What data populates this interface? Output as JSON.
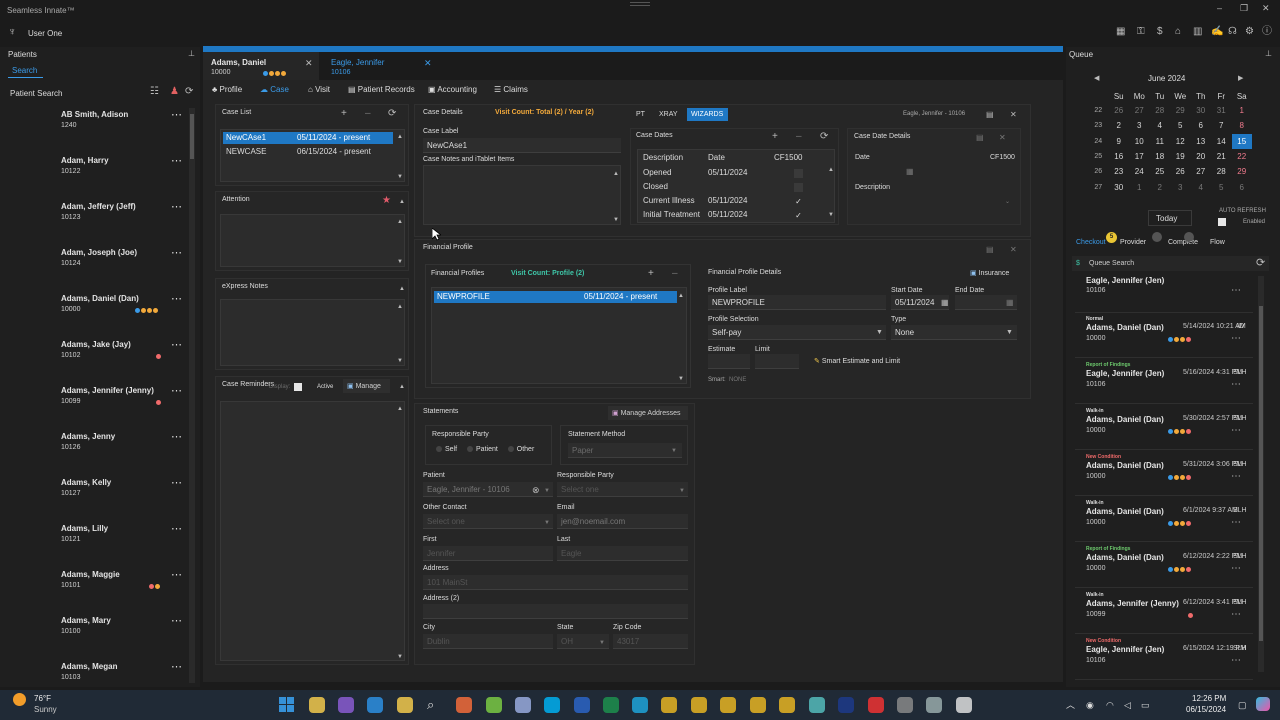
{
  "app": {
    "title": "Seamless Innate™",
    "user": "User One"
  },
  "sidebar": {
    "title": "Patients",
    "search_tab": "Search",
    "search_label": "Patient Search",
    "patients": [
      {
        "name": "AB Smith, Adison",
        "id": "1240",
        "dots": []
      },
      {
        "name": "Adam, Harry",
        "id": "10122",
        "dots": []
      },
      {
        "name": "Adam, Jeffery (Jeff)",
        "id": "10123",
        "dots": []
      },
      {
        "name": "Adam, Joseph (Joe)",
        "id": "10124",
        "dots": []
      },
      {
        "name": "Adams, Daniel (Dan)",
        "id": "10000",
        "dots": [
          "#3b9be8",
          "#f2a93b",
          "#f2a93b",
          "#f2a93b"
        ]
      },
      {
        "name": "Adams, Jake (Jay)",
        "id": "10102",
        "dots": [
          "#f06b6b"
        ]
      },
      {
        "name": "Adams, Jennifer (Jenny)",
        "id": "10099",
        "dots": [
          "#f06b6b"
        ]
      },
      {
        "name": "Adams, Jenny",
        "id": "10126",
        "dots": []
      },
      {
        "name": "Adams, Kelly",
        "id": "10127",
        "dots": []
      },
      {
        "name": "Adams, Lilly",
        "id": "10121",
        "dots": []
      },
      {
        "name": "Adams, Maggie",
        "id": "10101",
        "dots": [
          "#f06b6b",
          "#f2a93b"
        ]
      },
      {
        "name": "Adams, Mary",
        "id": "10100",
        "dots": []
      },
      {
        "name": "Adams, Megan",
        "id": "10103",
        "dots": []
      }
    ]
  },
  "tabs": [
    {
      "name": "Adams, Daniel",
      "id": "10000",
      "active": true
    },
    {
      "name": "Eagle, Jennifer",
      "id": "10106",
      "active": false
    }
  ],
  "nav": [
    "Profile",
    "Case",
    "Visit",
    "Patient Records",
    "Accounting",
    "Claims"
  ],
  "case_list": {
    "title": "Case List",
    "rows": [
      {
        "label": "NewCAse1",
        "dates": "05/11/2024 - present"
      },
      {
        "label": "NEWCASE",
        "dates": "06/15/2024 - present"
      }
    ]
  },
  "attention": {
    "title": "Attention"
  },
  "express_notes": {
    "title": "eXpress Notes"
  },
  "case_reminders": {
    "title": "Case Reminders",
    "display": "Display:",
    "active": "Active",
    "manage": "Manage"
  },
  "case_details": {
    "title": "Case Details",
    "visit_count": "Visit Count: Total (2) / Year (2)",
    "btn_pt": "PT",
    "btn_xray": "XRAY",
    "btn_wizards": "WIZARDS",
    "patient_ref": "Eagle, Jennifer - 10106",
    "case_label_lbl": "Case Label",
    "case_label": "NewCAse1",
    "notes_lbl": "Case Notes and iTablet Items"
  },
  "case_dates": {
    "title": "Case Dates",
    "headers": [
      "Description",
      "Date",
      "CF1500"
    ],
    "rows": [
      {
        "desc": "Opened",
        "date": "05/11/2024",
        "cf": false
      },
      {
        "desc": "Closed",
        "date": "",
        "cf": false
      },
      {
        "desc": "Current Illness",
        "date": "05/11/2024",
        "cf": true
      },
      {
        "desc": "Initial Treatment",
        "date": "05/11/2024",
        "cf": true
      }
    ]
  },
  "case_date_details": {
    "title": "Case Date Details",
    "date": "Date",
    "cf": "CF1500",
    "description": "Description"
  },
  "financial": {
    "title": "Financial Profile",
    "profiles_title": "Financial Profiles",
    "visit_count": "Visit Count: Profile (2)",
    "profile_row": {
      "label": "NEWPROFILE",
      "dates": "05/11/2024 - present"
    },
    "details_title": "Financial Profile Details",
    "insurance": "Insurance",
    "profile_label_lbl": "Profile Label",
    "profile_label": "NEWPROFILE",
    "start_lbl": "Start Date",
    "start": "05/11/2024",
    "end_lbl": "End Date",
    "selection_lbl": "Profile Selection",
    "selection": "Self-pay",
    "type_lbl": "Type",
    "type": "None",
    "estimate_lbl": "Estimate",
    "limit_lbl": "Limit",
    "smart_btn": "Smart Estimate and Limit",
    "smart_lbl": "Smart:",
    "smart_val": "NONE"
  },
  "statements": {
    "title": "Statements",
    "manage": "Manage Addresses",
    "resp_party": "Responsible Party",
    "opts": [
      "Self",
      "Patient",
      "Other"
    ],
    "method_lbl": "Statement Method",
    "method": "Paper",
    "patient_lbl": "Patient",
    "patient": "Eagle, Jennifer - 10106",
    "resp_lbl": "Responsible Party",
    "resp_ph": "Select one",
    "other_lbl": "Other Contact",
    "other_ph": "Select one",
    "email_lbl": "Email",
    "email": "jen@noemail.com",
    "first_lbl": "First",
    "first": "Jennifer",
    "last_lbl": "Last",
    "last": "Eagle",
    "addr_lbl": "Address",
    "addr": "101 MainSt",
    "addr2_lbl": "Address (2)",
    "city_lbl": "City",
    "city": "Dublin",
    "state_lbl": "State",
    "state": "OH",
    "zip_lbl": "Zip Code",
    "zip": "43017"
  },
  "queue": {
    "title": "Queue",
    "month": "June 2024",
    "days": [
      "Su",
      "Mo",
      "Tu",
      "We",
      "Th",
      "Fr",
      "Sa"
    ],
    "weeks": [
      {
        "wk": "22",
        "d": [
          "26",
          "27",
          "28",
          "29",
          "30",
          "31",
          "1"
        ]
      },
      {
        "wk": "23",
        "d": [
          "2",
          "3",
          "4",
          "5",
          "6",
          "7",
          "8"
        ]
      },
      {
        "wk": "24",
        "d": [
          "9",
          "10",
          "11",
          "12",
          "13",
          "14",
          "15"
        ]
      },
      {
        "wk": "25",
        "d": [
          "16",
          "17",
          "18",
          "19",
          "20",
          "21",
          "22"
        ]
      },
      {
        "wk": "26",
        "d": [
          "23",
          "24",
          "25",
          "26",
          "27",
          "28",
          "29"
        ]
      },
      {
        "wk": "27",
        "d": [
          "30",
          "1",
          "2",
          "3",
          "4",
          "5",
          "6"
        ]
      }
    ],
    "today": "Today",
    "auto_refresh": "AUTO REFRESH",
    "enabled": "Enabled",
    "tabs": [
      {
        "label": "Checkout",
        "badge": "5"
      },
      {
        "label": "Provider",
        "badge": ""
      },
      {
        "label": "Complete",
        "badge": ""
      },
      {
        "label": "Flow",
        "badge": ""
      }
    ],
    "search": "Queue Search",
    "items": [
      {
        "type": "",
        "name": "Eagle, Jennifer (Jen)",
        "id": "10106",
        "date": "",
        "prov": "",
        "dots": [],
        "tcolor": "#ddd"
      },
      {
        "type": "Normal",
        "name": "Adams, Daniel (Dan)",
        "id": "10000",
        "date": "5/14/2024 10:21 AM",
        "prov": "ID",
        "dots": [
          "#3b9be8",
          "#f2a93b",
          "#f2a93b",
          "#f06b6b"
        ],
        "tcolor": "#ddd"
      },
      {
        "type": "Report of Findings",
        "name": "Eagle, Jennifer (Jen)",
        "id": "10106",
        "date": "5/16/2024 4:31 PM",
        "prov": "SLH",
        "dots": [],
        "tcolor": "#6ecb6e"
      },
      {
        "type": "Walk-in",
        "name": "Adams, Daniel (Dan)",
        "id": "10000",
        "date": "5/30/2024 2:57 PM",
        "prov": "SLH",
        "dots": [
          "#3b9be8",
          "#f2a93b",
          "#f2a93b",
          "#f06b6b"
        ],
        "tcolor": "#ddd"
      },
      {
        "type": "New Condition",
        "name": "Adams, Daniel (Dan)",
        "id": "10000",
        "date": "5/31/2024 3:06 PM",
        "prov": "SLH",
        "dots": [
          "#3b9be8",
          "#f2a93b",
          "#f2a93b",
          "#f06b6b"
        ],
        "tcolor": "#f06b6b"
      },
      {
        "type": "Walk-in",
        "name": "Adams, Daniel (Dan)",
        "id": "10000",
        "date": "6/1/2024 9:37 AM",
        "prov": "SLH",
        "dots": [
          "#3b9be8",
          "#f2a93b",
          "#f2a93b",
          "#f06b6b"
        ],
        "tcolor": "#ddd"
      },
      {
        "type": "Report of Findings",
        "name": "Adams, Daniel (Dan)",
        "id": "10000",
        "date": "6/12/2024 2:22 PM",
        "prov": "SLH",
        "dots": [
          "#3b9be8",
          "#f2a93b",
          "#f2a93b",
          "#f06b6b"
        ],
        "tcolor": "#6ecb6e"
      },
      {
        "type": "Walk-in",
        "name": "Adams, Jennifer (Jenny)",
        "id": "10099",
        "date": "6/12/2024 3:41 PM",
        "prov": "SLH",
        "dots": [
          "#f06b6b"
        ],
        "tcolor": "#ddd"
      },
      {
        "type": "New Condition",
        "name": "Eagle, Jennifer (Jen)",
        "id": "10106",
        "date": "6/15/2024 12:19 PM",
        "prov": "SLH",
        "dots": [],
        "tcolor": "#f06b6b"
      }
    ]
  },
  "taskbar": {
    "temp": "76°F",
    "weather": "Sunny",
    "time": "12:26 PM",
    "date": "06/15/2024"
  }
}
